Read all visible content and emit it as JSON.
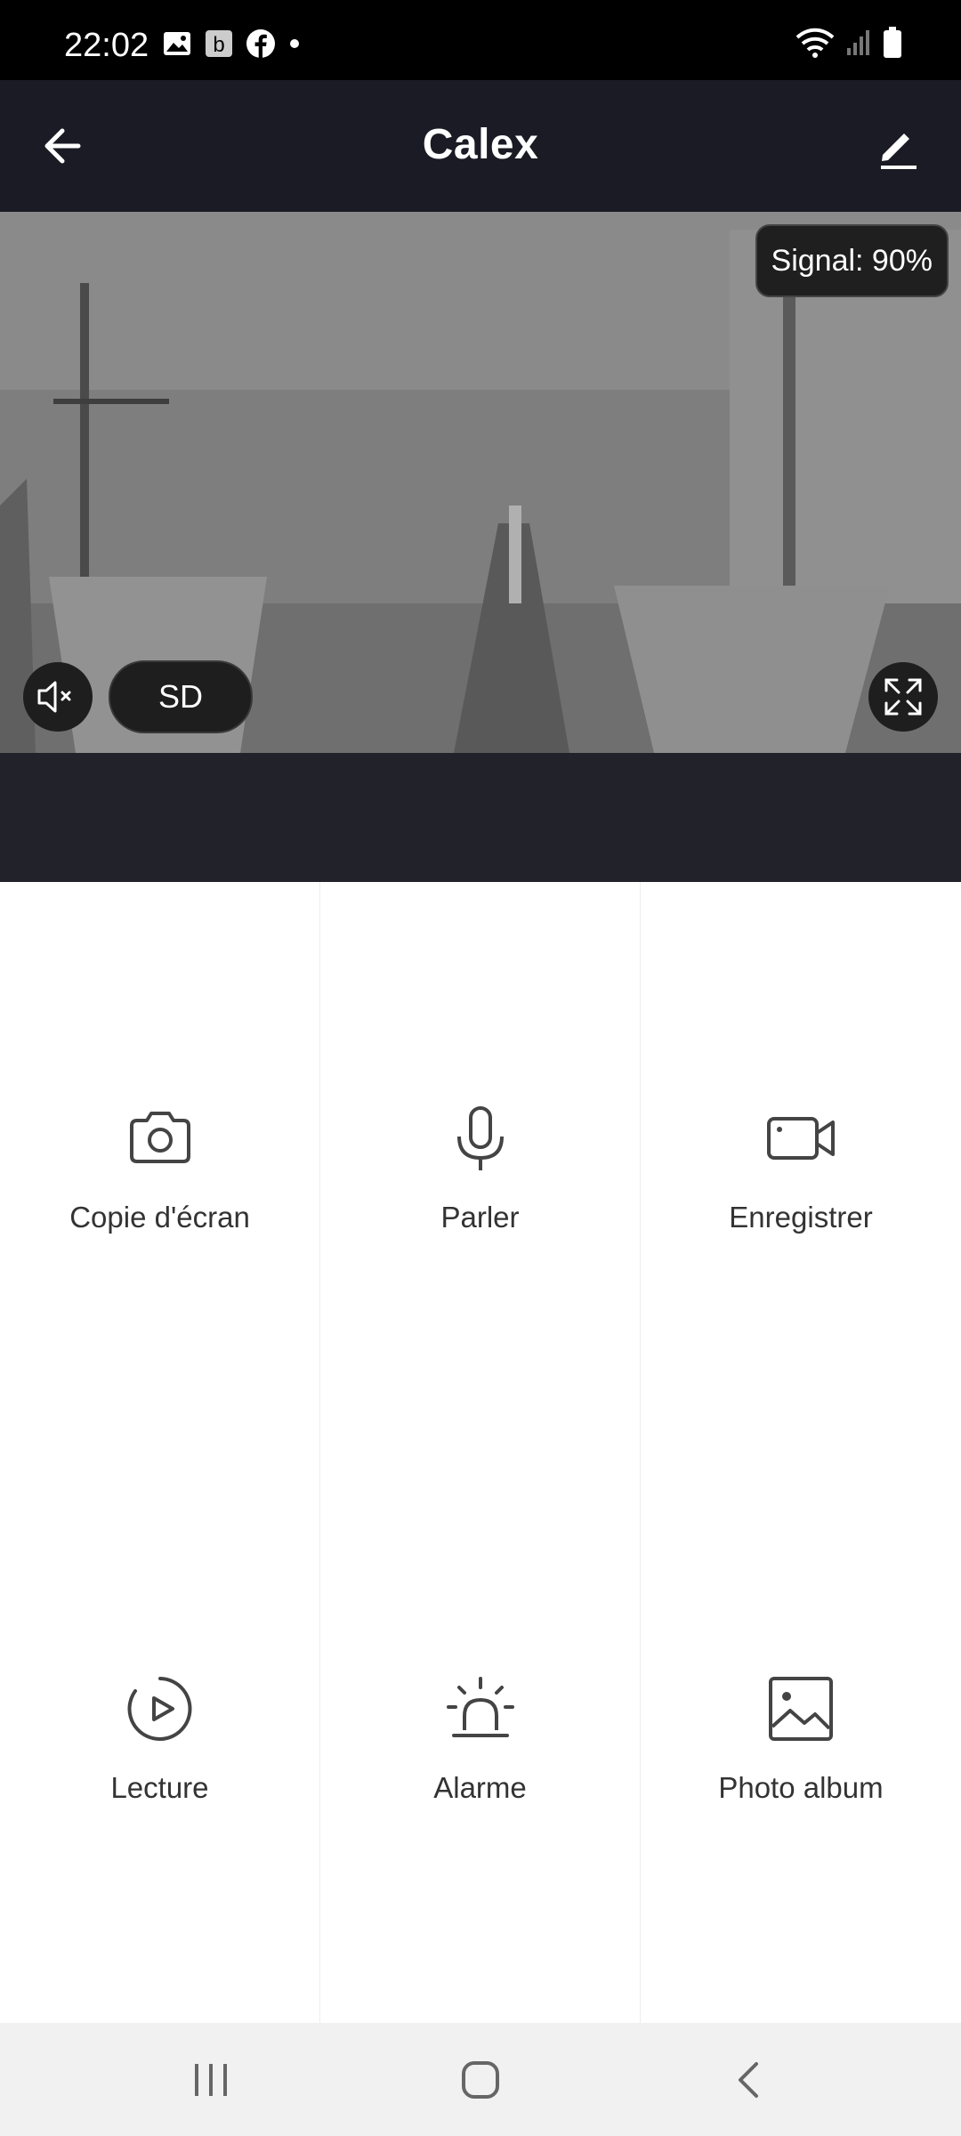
{
  "status": {
    "time": "22:02"
  },
  "app_bar": {
    "title": "Calex"
  },
  "video": {
    "signal": "Signal: 90%",
    "quality": "SD"
  },
  "actions": [
    {
      "icon": "camera-icon",
      "label": "Copie d'écran"
    },
    {
      "icon": "microphone-icon",
      "label": "Parler"
    },
    {
      "icon": "video-camera-icon",
      "label": "Enregistrer"
    },
    {
      "icon": "playback-icon",
      "label": "Lecture"
    },
    {
      "icon": "alarm-siren-icon",
      "label": "Alarme"
    },
    {
      "icon": "image-icon",
      "label": "Photo album"
    }
  ],
  "colors": {
    "app_bar": "#1a1b24",
    "status_bar": "#000000",
    "icon": "#444444"
  }
}
